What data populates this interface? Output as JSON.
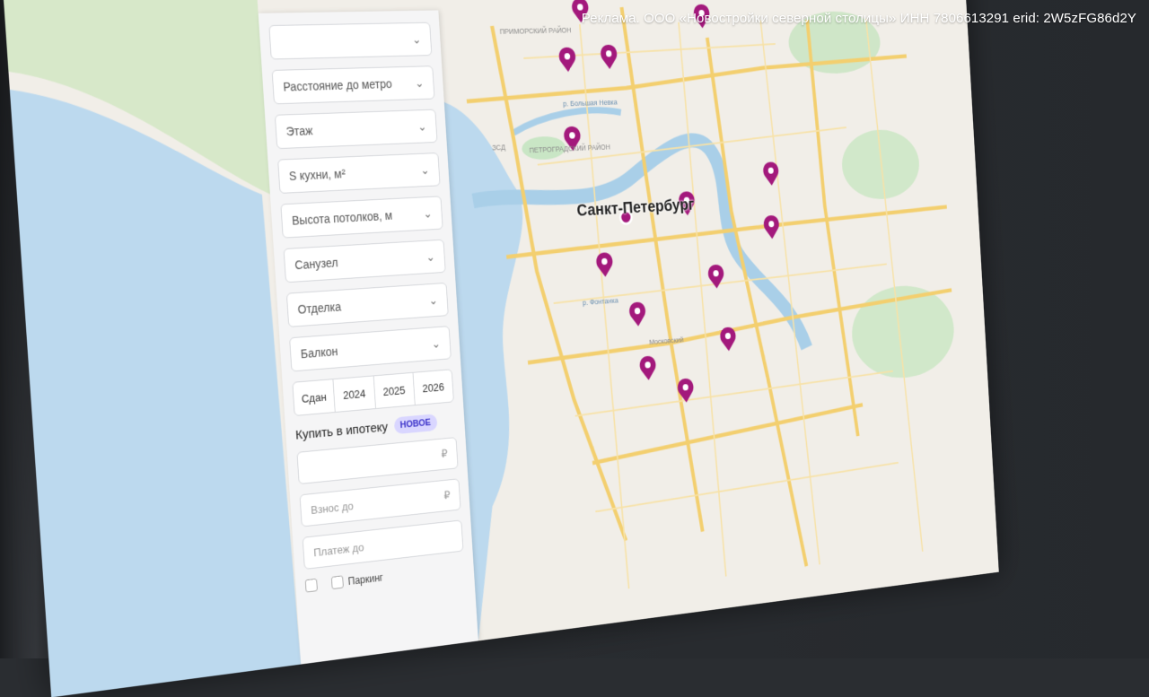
{
  "ad_notice": "Реклама. ООО «Новостройки северной столицы» ИНН 7806613291 erid: 2W5zFG86d2Y",
  "filters": {
    "top_field": "",
    "fields": [
      {
        "label": "Расстояние до метро"
      },
      {
        "label": "Этаж"
      },
      {
        "label": "S кухни, м²"
      },
      {
        "label": "Высота потолков, м"
      },
      {
        "label": "Санузел"
      },
      {
        "label": "Отделка"
      },
      {
        "label": "Балкон"
      }
    ],
    "years": [
      "Сдан",
      "2024",
      "2025",
      "2026"
    ],
    "mortgage_label": "Купить в ипотеку",
    "mortgage_badge": "НОВОЕ",
    "inputs": [
      {
        "placeholder": "",
        "currency": "₽"
      },
      {
        "placeholder": "Взнос до",
        "currency": "₽"
      },
      {
        "placeholder": "Платеж до",
        "currency": ""
      }
    ],
    "checkboxes": [
      "",
      "Паркинг"
    ]
  },
  "map": {
    "city_label": "Санкт-Петербург",
    "district_labels": [
      "ПЕТРОГРАДСКИЙ РАЙОН",
      "ПРИМОРСКИЙ РАЙОН"
    ],
    "street_labels": [
      "р. Большая Невка",
      "р. Фонтанка",
      "ЗСД",
      "Московский"
    ],
    "pin_color": "#a3197c",
    "water_color": "#bcd9ee",
    "park_color": "#c9e6c5"
  }
}
